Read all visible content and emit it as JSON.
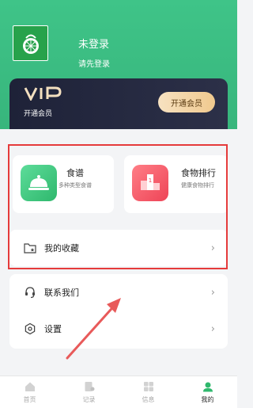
{
  "user": {
    "name": "未登录",
    "subtitle": "请先登录"
  },
  "vip": {
    "badge": "VIP",
    "description": "开通会员",
    "button_label": "开通会员"
  },
  "features": [
    {
      "title": "食谱",
      "subtitle": "多种类型食谱",
      "icon": "cloche-icon"
    },
    {
      "title": "食物排行",
      "subtitle": "健康食物排行",
      "icon": "podium-icon"
    }
  ],
  "menu": {
    "favorites": "我的收藏",
    "contact": "联系我们",
    "settings": "设置"
  },
  "tabs": [
    {
      "label": "首页",
      "icon": "home-icon"
    },
    {
      "label": "记录",
      "icon": "record-icon"
    },
    {
      "label": "信息",
      "icon": "info-icon"
    },
    {
      "label": "我的",
      "icon": "profile-icon",
      "active": true
    }
  ],
  "colors": {
    "brand_green": "#3fc488",
    "highlight_red": "#e53b3b",
    "vip_dark": "#1e2238",
    "vip_gold": "#f0c98e"
  }
}
